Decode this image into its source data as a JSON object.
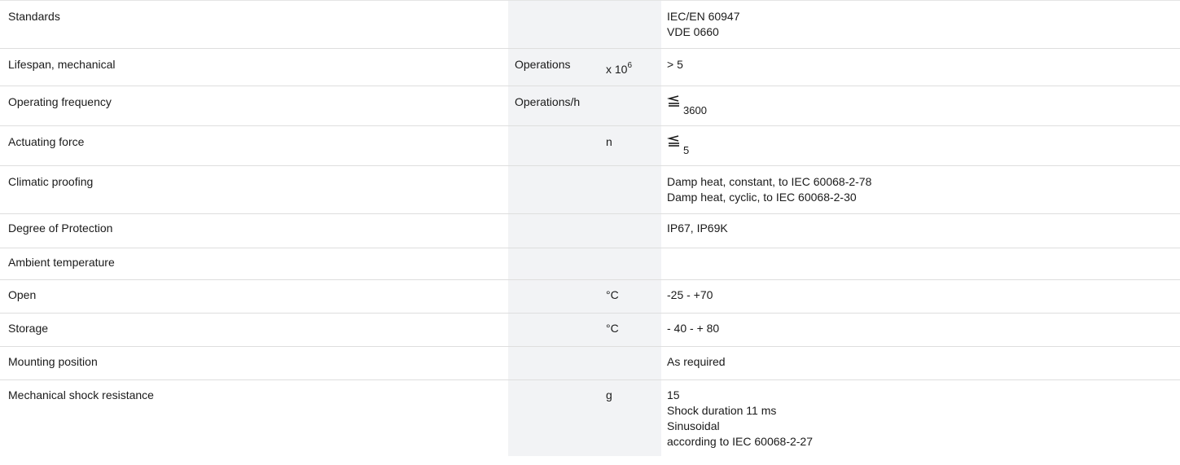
{
  "rows": {
    "standards": {
      "property": "Standards",
      "values": [
        "IEC/EN 60947",
        "VDE 0660"
      ]
    },
    "lifespan": {
      "property": "Lifespan, mechanical",
      "unit": "Operations",
      "multiplier_base": "x 10",
      "multiplier_exp": "6",
      "value": "> 5"
    },
    "frequency": {
      "property": "Operating frequency",
      "unit": "Operations/h",
      "symbol": "less-than-or-equal-icon",
      "value": "3600"
    },
    "force": {
      "property": "Actuating force",
      "multiplier": "n",
      "symbol": "less-than-or-equal-icon",
      "value": "5"
    },
    "climatic": {
      "property": "Climatic proofing",
      "values": [
        "Damp heat, constant, to IEC 60068-2-78",
        "Damp heat, cyclic, to IEC 60068-2-30"
      ]
    },
    "protection": {
      "property": "Degree of Protection",
      "value": "IP67, IP69K"
    },
    "ambient": {
      "property": "Ambient temperature"
    },
    "open": {
      "property": "Open",
      "multiplier": "°C",
      "value": "-25 - +70"
    },
    "storage": {
      "property": "Storage",
      "multiplier": "°C",
      "value": "- 40 - + 80"
    },
    "mounting": {
      "property": "Mounting position",
      "value": "As required"
    },
    "shock": {
      "property": "Mechanical shock resistance",
      "multiplier": "g",
      "values": [
        "15",
        "Shock duration 11 ms",
        "Sinusoidal",
        "according to IEC 60068-2-27"
      ]
    }
  }
}
